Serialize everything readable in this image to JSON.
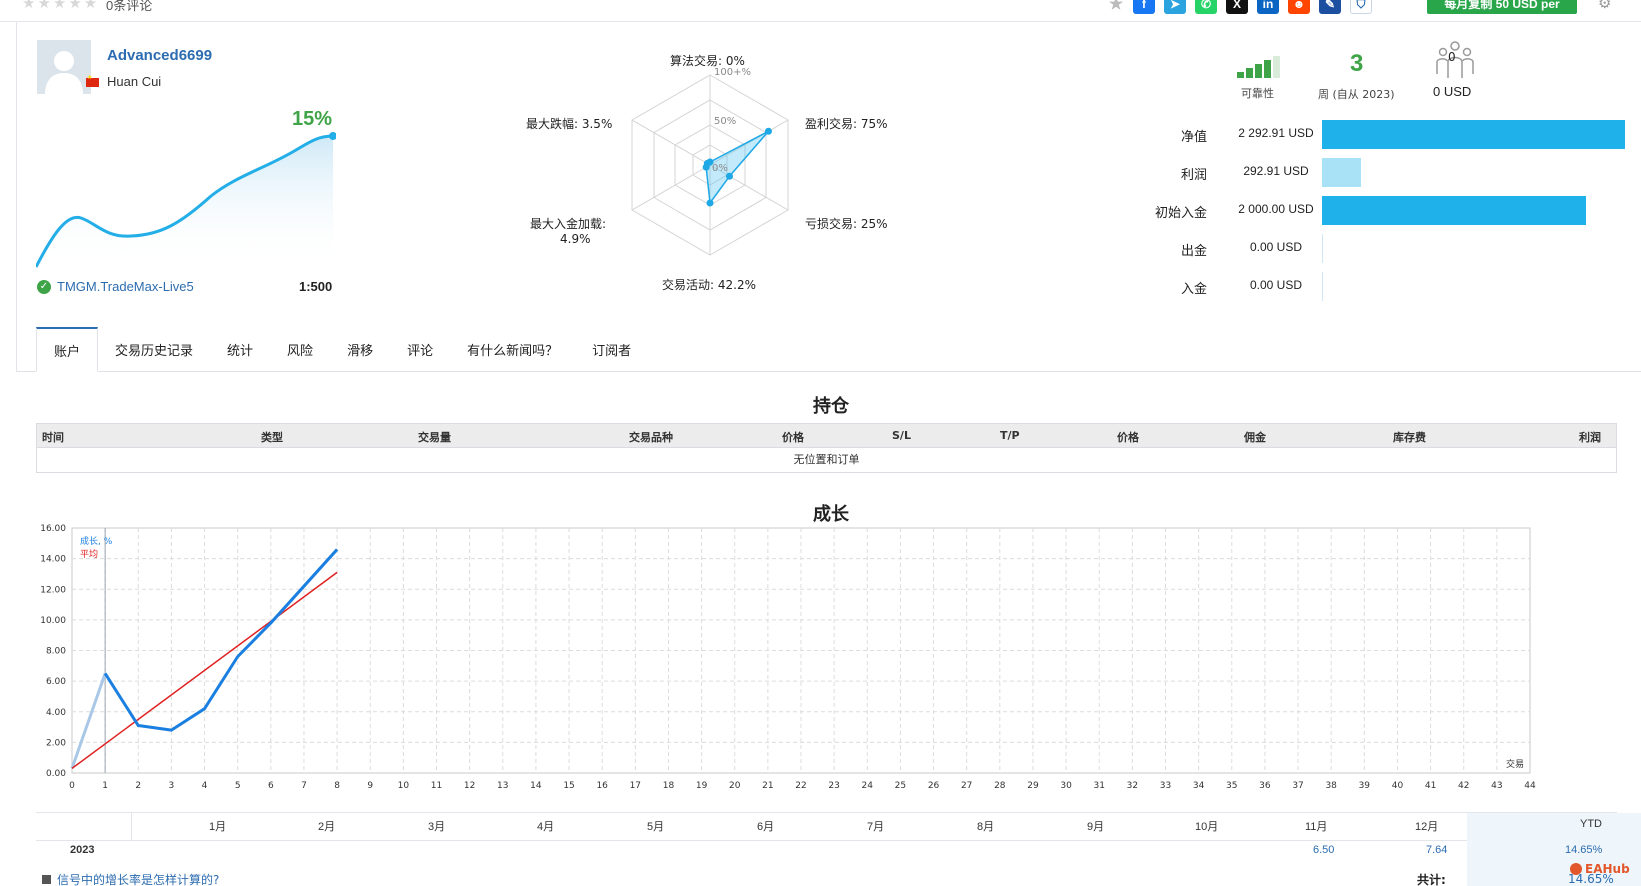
{
  "header": {
    "review_count": "0条评论",
    "subscribe_label": "每月复制 50 USD per",
    "share_icons": [
      "facebook-icon",
      "telegram-icon",
      "whatsapp-icon",
      "x-icon",
      "linkedin-icon",
      "reddit-icon",
      "weibo-icon",
      "shield-icon"
    ]
  },
  "profile": {
    "username": "Advanced6699",
    "real_name": "Huan Cui",
    "growth": "15%",
    "server": "TMGM.TradeMax-Live5",
    "leverage": "1:500"
  },
  "radar": {
    "labels": {
      "algo": "算法交易: 0%",
      "profit": "盈利交易: 75%",
      "loss": "亏损交易: 25%",
      "activity": "交易活动: 42.2%",
      "deposit_load_1": "最大入金加载:",
      "deposit_load_2": "4.9%",
      "drawdown": "最大跌幅: 3.5%"
    },
    "scale": [
      "100+%",
      "50%",
      "0%"
    ],
    "values": {
      "algo": 0,
      "profit": 75,
      "loss": 25,
      "activity": 42.2,
      "deposit_load": 4.9,
      "drawdown": 3.5
    }
  },
  "metrics": {
    "reliability_label": "可靠性",
    "weeks": "3",
    "weeks_label": "周 (自从 2023)",
    "subscribers": "0",
    "subscription_funds": "0 USD"
  },
  "finance": [
    {
      "label": "净值",
      "value": "2 292.91 USD",
      "bar_fraction": 1.0,
      "color": "#1fb2ea"
    },
    {
      "label": "利润",
      "value": "292.91 USD",
      "bar_fraction": 0.128,
      "color": "#a9e1f6"
    },
    {
      "label": "初始入金",
      "value": "2 000.00 USD",
      "bar_fraction": 0.872,
      "color": "#1fb2ea"
    },
    {
      "label": "出金",
      "value": "0.00 USD",
      "bar_fraction": 0,
      "color": "#1fb2ea"
    },
    {
      "label": "入金",
      "value": "0.00 USD",
      "bar_fraction": 0,
      "color": "#1fb2ea"
    }
  ],
  "tabs": [
    "账户",
    "交易历史记录",
    "统计",
    "风险",
    "滑移",
    "评论",
    "有什么新闻吗？",
    "订阅者"
  ],
  "positions": {
    "title": "持仓",
    "columns": [
      "时间",
      "类型",
      "交易量",
      "交易品种",
      "价格",
      "S/L",
      "T/P",
      "价格",
      "佣金",
      "库存费",
      "利润"
    ],
    "empty_text": "无位置和订单"
  },
  "growth_chart": {
    "title": "成长",
    "legend_growth": "成长, %",
    "legend_avg": "平均",
    "x_axis_label": "交易",
    "months": [
      "1月",
      "2月",
      "3月",
      "4月",
      "5月",
      "6月",
      "7月",
      "8月",
      "9月",
      "10月",
      "11月",
      "12月"
    ],
    "ytd_label": "YTD"
  },
  "chart_data": {
    "type": "line",
    "title": "成长",
    "xlabel": "交易",
    "ylabel": "",
    "xlim": [
      0,
      44
    ],
    "ylim": [
      0,
      16
    ],
    "y_ticks": [
      "0.00",
      "2.00",
      "4.00",
      "6.00",
      "8.00",
      "10.00",
      "12.00",
      "14.00",
      "16.00"
    ],
    "x_ticks": [
      0,
      1,
      2,
      3,
      4,
      5,
      6,
      7,
      8,
      9,
      10,
      11,
      12,
      13,
      14,
      15,
      16,
      17,
      18,
      19,
      20,
      21,
      22,
      23,
      24,
      25,
      26,
      27,
      28,
      29,
      30,
      31,
      32,
      33,
      34,
      35,
      36,
      37,
      38,
      39,
      40,
      41,
      42,
      43,
      44
    ],
    "series": [
      {
        "name": "成长, %",
        "x": [
          0,
          1,
          2,
          3,
          4,
          5,
          6,
          7,
          8
        ],
        "values": [
          0.3,
          6.5,
          3.1,
          2.8,
          4.2,
          7.6,
          9.8,
          12.2,
          14.6
        ],
        "color": "#1a7fe0"
      },
      {
        "name": "平均",
        "x": [
          0,
          8
        ],
        "values": [
          0.3,
          13.1
        ],
        "color": "#e02020"
      }
    ]
  },
  "monthly": {
    "year": "2023",
    "nov": "6.50",
    "dec": "7.64",
    "ytd": "14.65%",
    "faq": "信号中的增长率是怎样计算的?",
    "total_label": "共计:",
    "total_value": "14.65%"
  },
  "watermark": "EAHub"
}
